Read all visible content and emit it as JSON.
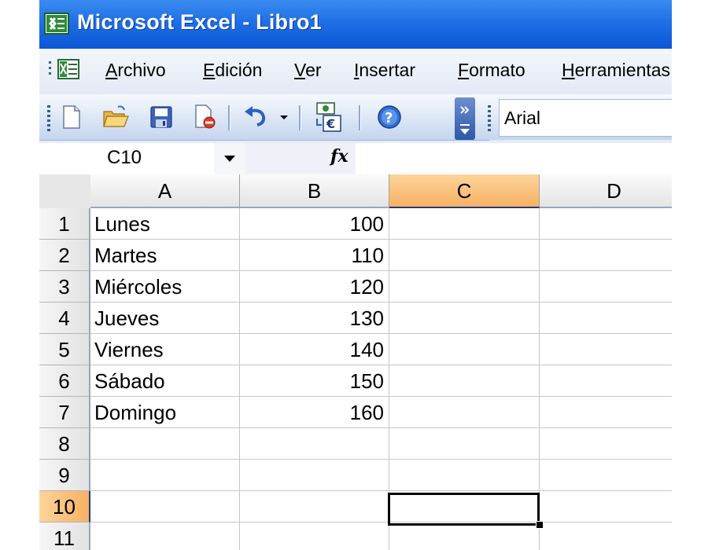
{
  "window": {
    "title": "Microsoft Excel - Libro1"
  },
  "menu": {
    "items": [
      {
        "label": "Archivo",
        "mnemonic": "A",
        "rest": "rchivo"
      },
      {
        "label": "Edición",
        "mnemonic": "E",
        "rest": "dición"
      },
      {
        "label": "Ver",
        "mnemonic": "V",
        "rest": "er"
      },
      {
        "label": "Insertar",
        "mnemonic": "I",
        "rest": "nsertar"
      },
      {
        "label": "Formato",
        "mnemonic": "F",
        "rest": "ormato"
      },
      {
        "label": "Herramientas",
        "mnemonic": "H",
        "rest": "erramientas"
      }
    ]
  },
  "toolbar": {
    "icons": [
      "new-icon",
      "open-folder-icon",
      "save-icon",
      "print-preview-icon",
      "undo-icon",
      "undo-dropdown-icon",
      "euro-conversion-icon",
      "help-icon"
    ],
    "font_name": "Arial"
  },
  "formula_bar": {
    "name_box": "C10",
    "fx": "fx",
    "formula": ""
  },
  "sheet": {
    "columns": [
      "A",
      "B",
      "C",
      "D"
    ],
    "active_column": "C",
    "active_row": 10,
    "rows": [
      {
        "n": "1",
        "a": "Lunes",
        "b": "100"
      },
      {
        "n": "2",
        "a": "Martes",
        "b": "110"
      },
      {
        "n": "3",
        "a": "Miércoles",
        "b": "120"
      },
      {
        "n": "4",
        "a": "Jueves",
        "b": "130"
      },
      {
        "n": "5",
        "a": "Viernes",
        "b": "140"
      },
      {
        "n": "6",
        "a": "Sábado",
        "b": "150"
      },
      {
        "n": "7",
        "a": "Domingo",
        "b": "160"
      },
      {
        "n": "8",
        "a": "",
        "b": ""
      },
      {
        "n": "9",
        "a": "",
        "b": ""
      },
      {
        "n": "10",
        "a": "",
        "b": ""
      },
      {
        "n": "11",
        "a": "",
        "b": ""
      }
    ]
  },
  "colors": {
    "title_bar": "#0b56d6",
    "selection_header": "#f7b164",
    "grid_line": "#c6c6c6"
  }
}
